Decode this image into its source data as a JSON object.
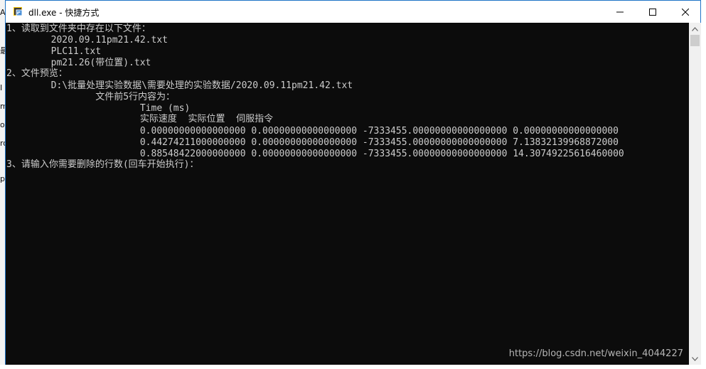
{
  "window": {
    "title": "dll.exe - 快捷方式",
    "icon": "exe-shortcut-icon",
    "controls": {
      "minimize": "minimize-icon",
      "maximize": "maximize-icon",
      "close": "close-icon"
    }
  },
  "background_app": {
    "chars": [
      "A",
      "最",
      "I",
      "m",
      "o",
      "ro",
      "p"
    ]
  },
  "console": {
    "lines": [
      "1、读取到文件夹中存在以下文件：",
      "        2020.09.11pm21.42.txt",
      "        PLC11.txt",
      "        pm21.26(带位置).txt",
      "2、文件预览：",
      "        D:\\批量处理实验数据\\需要处理的实验数据/2020.09.11pm21.42.txt",
      "                文件前5行内容为：",
      "                        Time (ms)",
      "                        实际速度  实际位置  伺服指令",
      "                        0.00000000000000000 0.00000000000000000 -7333455.00000000000000000 0.00000000000000000",
      "                        0.44274211000000000 0.00000000000000000 -7333455.00000000000000000 7.13832139968872000",
      "                        0.88548422000000000 0.00000000000000000 -7333455.00000000000000000 14.30749225616460000",
      "3、请输入你需要删除的行数(回车开始执行)："
    ]
  },
  "watermark": "https://blog.csdn.net/weixin_4044227",
  "scrollbar": {
    "up": "scroll-up-arrow-icon",
    "down": "scroll-down-arrow-icon"
  },
  "colors": {
    "console_bg": "#0c0c0c",
    "console_text": "#cccccc",
    "border": "#1f74c7"
  }
}
